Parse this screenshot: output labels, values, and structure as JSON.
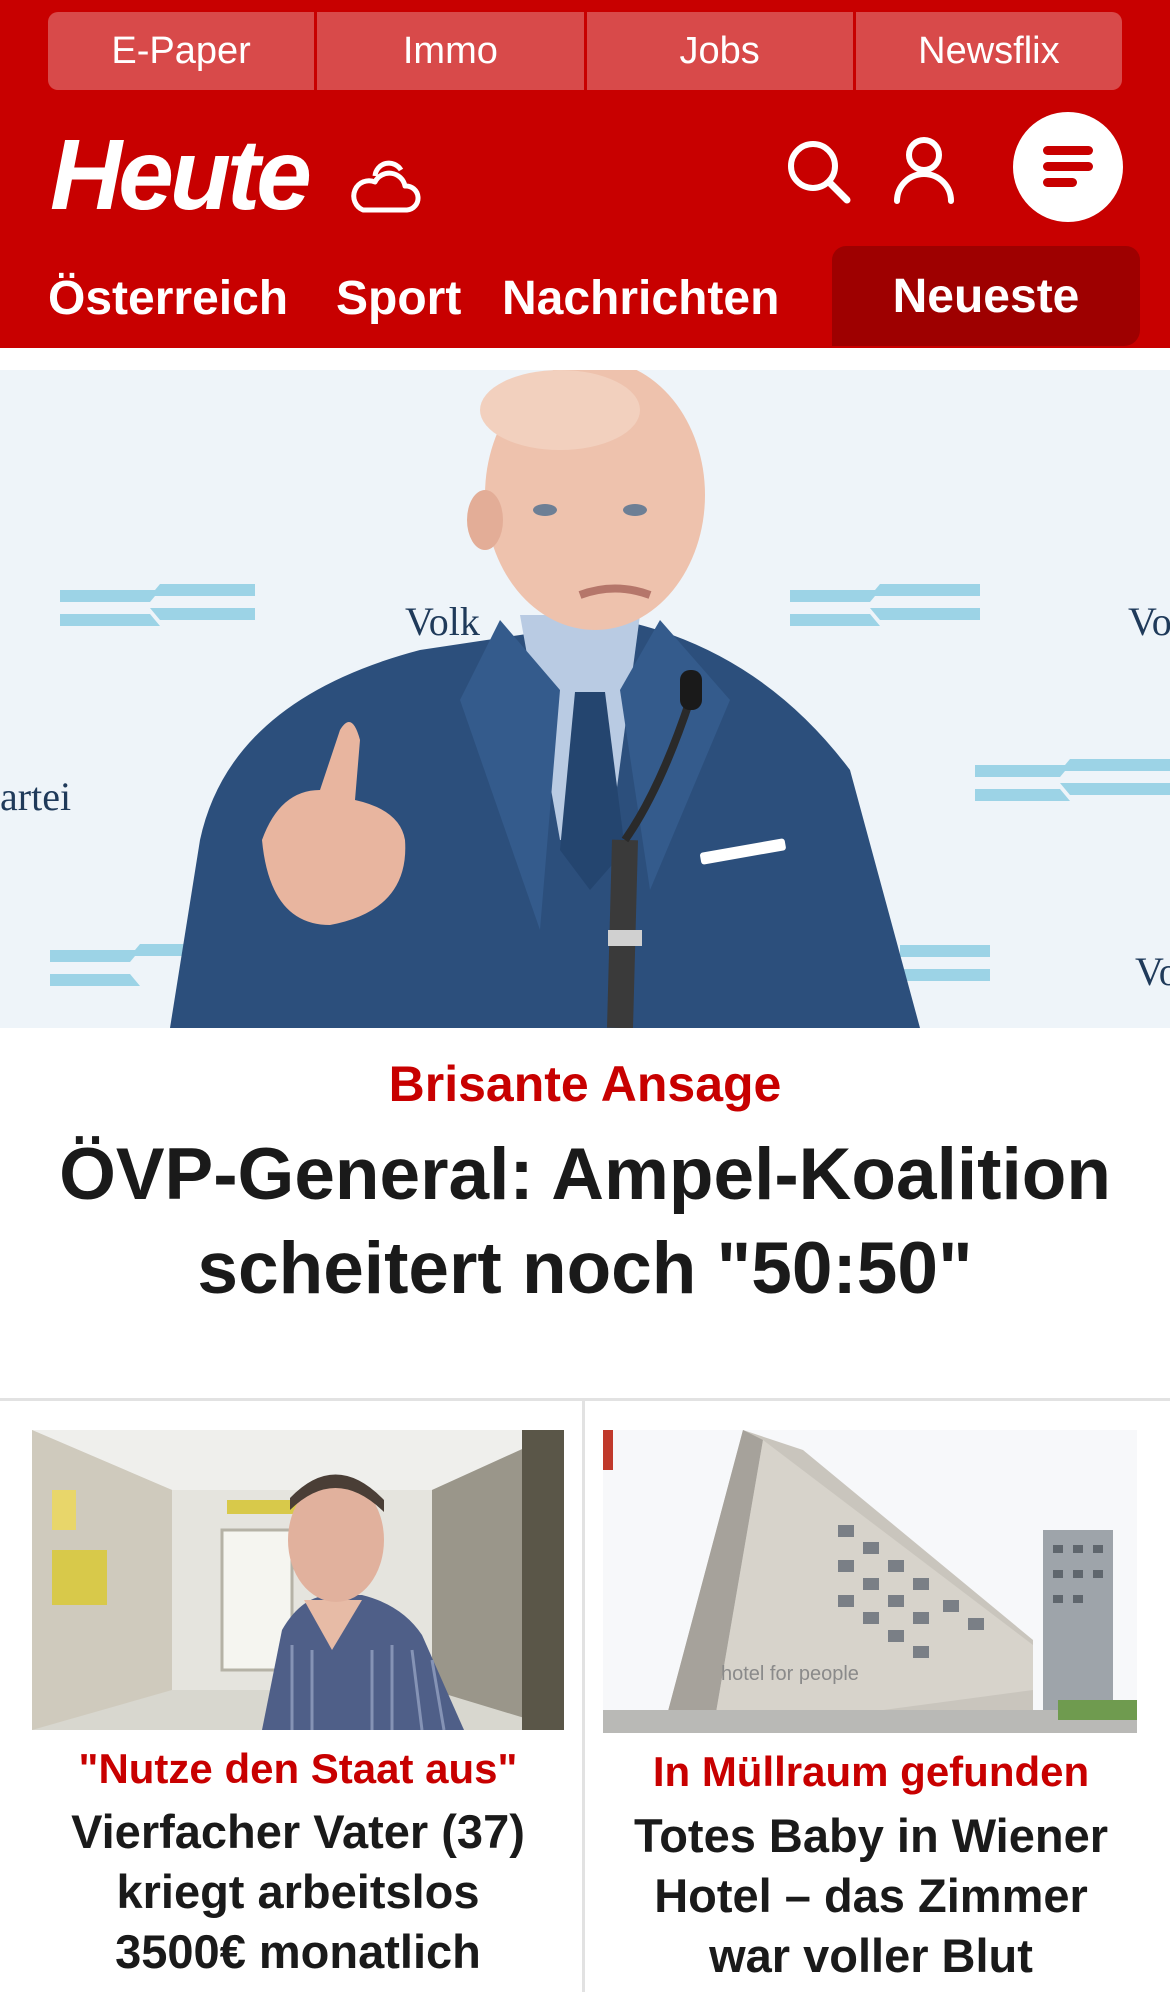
{
  "topbar": {
    "links": [
      "E-Paper",
      "Immo",
      "Jobs",
      "Newsflix"
    ]
  },
  "brand": {
    "logo_text": "Heute",
    "accent_color": "#c80000",
    "active_tab_color": "#9e0000"
  },
  "header_icons": {
    "weather": "cloud-sun-icon",
    "search": "search-icon",
    "account": "user-icon",
    "menu": "hamburger-menu-icon"
  },
  "nav": {
    "items": [
      "Österreich",
      "Sport",
      "Nachrichten"
    ],
    "active": "Neueste"
  },
  "lead": {
    "image": "politician-speaking-at-podium-photo",
    "backdrop_texts": [
      "Volk",
      "Vo",
      "artei",
      "Vo"
    ],
    "kicker": "Brisante Ansage",
    "headline_line1": "ÖVP-General: Ampel-Koalition",
    "headline_line2": "scheitert noch \"50:50\""
  },
  "cards": [
    {
      "image": "man-in-hallway-photo",
      "kicker": "\"Nutze den Staat aus\"",
      "title_lines": [
        "Vierfacher Vater (37)",
        "kriegt arbeitslos",
        "3500€ monatlich"
      ]
    },
    {
      "image": "hotel-building-photo",
      "kicker": "In Müllraum gefunden",
      "title_lines": [
        "Totes Baby in Wiener",
        "Hotel – das Zimmer",
        "war voller Blut"
      ]
    }
  ]
}
